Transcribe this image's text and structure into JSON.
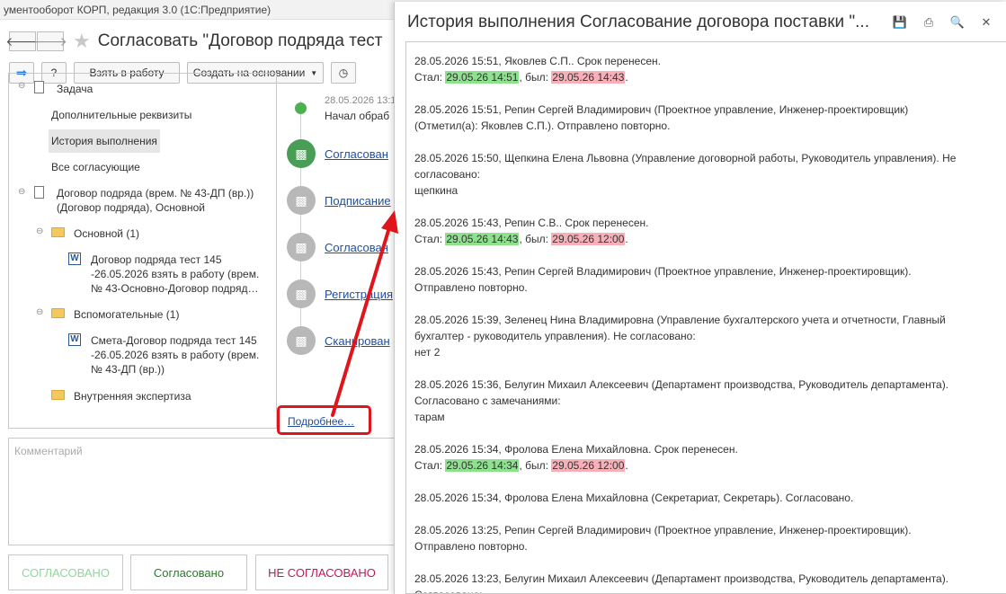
{
  "app_title": "ументооборот КОРП, редакция 3.0  (1С:Предприятие)",
  "main": {
    "title": "Согласовать \"Договор подряда тест",
    "toolbar": {
      "take": "Взять в работу",
      "create": "Создать на основании"
    },
    "tree": {
      "task": "Задача",
      "extra": "Дополнительные реквизиты",
      "history": "История выполнения",
      "approvers": "Все согласующие",
      "contract_line1": "Договор подряда (врем. № 43-ДП (вр.))",
      "contract_line2": "(Договор подряда), Основной",
      "main_folder": "Основной (1)",
      "doc1_line1": "Договор подряда тест 145",
      "doc1_line2": "-26.05.2026 взять в работу (врем.",
      "doc1_line3": "№ 43-Основно-Договор подряд…",
      "aux_folder": "Вспомогательные (1)",
      "doc2_line1": "Смета-Договор подряда тест 145",
      "doc2_line2": "-26.05.2026 взять в работу (врем.",
      "doc2_line3": "№ 43-ДП (вр.))",
      "expert_folder": "Внутренняя экспертиза"
    },
    "timeline": {
      "ts": "28.05.2026 13:1",
      "start": "Начал обраб",
      "s1": "Согласован",
      "s2": "Подписание",
      "s3": "Согласован",
      "s4": "Регистрация",
      "s5": "Сканирован"
    },
    "more": "Подробнее…",
    "comment_placeholder": "Комментарий",
    "buttons": {
      "approved_caps": "СОГЛАСОВАНО",
      "approved": "Согласовано",
      "not_approved": "НЕ СОГЛАСОВАНО"
    }
  },
  "popup": {
    "title": "История выполнения Согласование договора поставки \"...",
    "entries": [
      {
        "line1": "28.05.2026 15:51, Яковлев С.П.. Срок перенесен.",
        "became": "Стал: ",
        "new": "29.05.26 14:51",
        "was": ", был: ",
        "old": "29.05.26 14:43",
        "end": "."
      },
      {
        "line1": "28.05.2026 15:51, Репин Сергей Владимирович (Проектное управление, Инженер-проектировщик)",
        "line2": "(Отметил(а): Яковлев С.П.). Отправлено повторно."
      },
      {
        "line1": "28.05.2026 15:50, Щепкина Елена Львовна (Управление договорной работы, Руководитель управления). Не",
        "line2": "согласовано:",
        "line3": "щепкина"
      },
      {
        "line1": "28.05.2026 15:43, Репин С.В.. Срок перенесен.",
        "became": "Стал: ",
        "new": "29.05.26 14:43",
        "was": ", был: ",
        "old": "29.05.26 12:00",
        "end": "."
      },
      {
        "line1": "28.05.2026 15:43, Репин Сергей Владимирович (Проектное управление, Инженер-проектировщик).",
        "line2": "Отправлено повторно."
      },
      {
        "line1": "28.05.2026 15:39, Зеленец Нина Владимировна (Управление бухгалтерского учета и отчетности, Главный",
        "line2": "бухгалтер - руководитель управления). Не согласовано:",
        "line3": "нет 2"
      },
      {
        "line1": "28.05.2026 15:36, Белугин Михаил Алексеевич (Департамент производства, Руководитель департамента).",
        "line2": "Согласовано с замечаниями:",
        "line3": "тарам"
      },
      {
        "line1": "28.05.2026 15:34, Фролова Елена Михайловна. Срок перенесен.",
        "became": "Стал: ",
        "new": "29.05.26 14:34",
        "was": ", был: ",
        "old": "29.05.26 12:00",
        "end": "."
      },
      {
        "line1": "28.05.2026 15:34, Фролова Елена Михайловна (Секретариат, Секретарь). Согласовано."
      },
      {
        "line1": "28.05.2026 13:25, Репин Сергей Владимирович (Проектное управление, Инженер-проектировщик).",
        "line2": "Отправлено повторно."
      },
      {
        "line1": "28.05.2026 13:23, Белугин Михаил Алексеевич (Департамент производства, Руководитель департамента).",
        "line2": "Согласовано:"
      }
    ]
  },
  "colors": {
    "highlight_new": "#8fe08f",
    "highlight_old": "#f7b0b8",
    "annotation": "#e0141b",
    "link": "#1f4e9e"
  }
}
